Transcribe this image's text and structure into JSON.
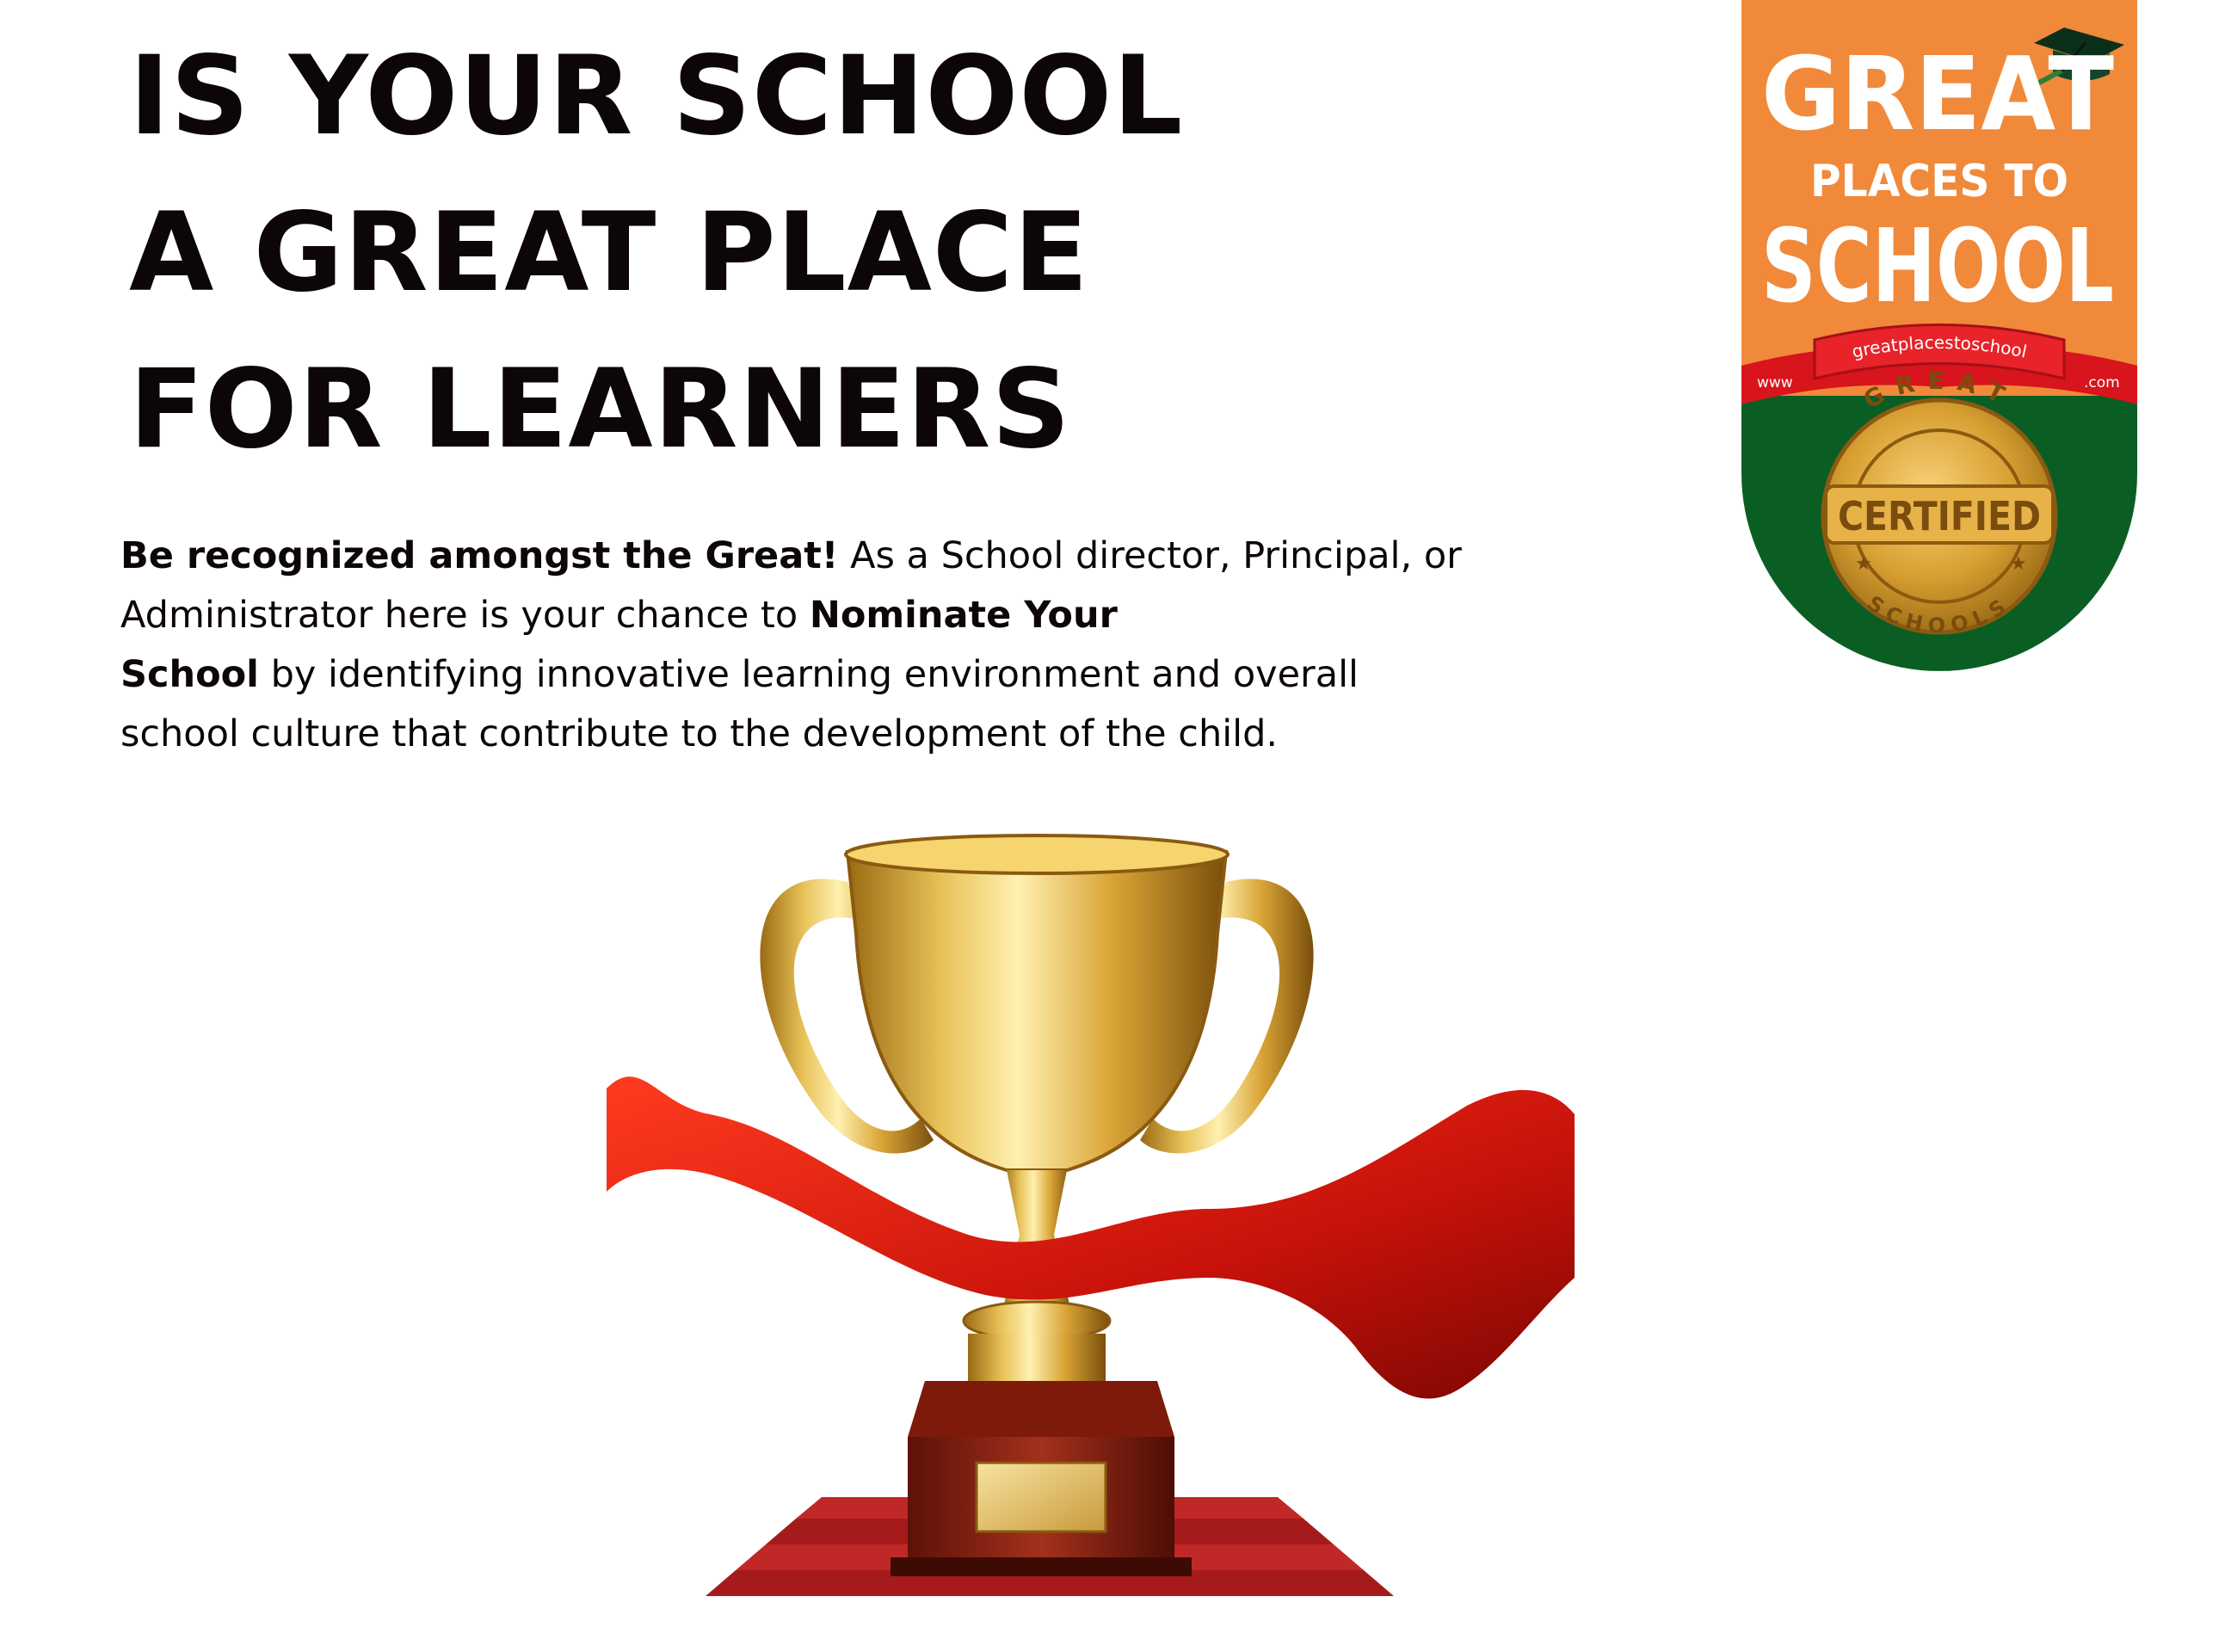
{
  "headline": {
    "lines": [
      "IS YOUR SCHOOL",
      "A GREAT PLACE",
      "FOR LEARNERS"
    ]
  },
  "intro": {
    "bold_lead": "Be recognized amongst the Great!",
    "text_1": " As a School director, Principal, or Administrator here is your chance to ",
    "bold_mid_1": "Nominate Your",
    "bold_mid_2": "School",
    "text_2": " by identifying innovative learning environment and overall school culture that contribute to the development of the child."
  },
  "badge": {
    "line_great": "GREAT",
    "line_places": "PLACES TO",
    "line_school": "SCHOOL",
    "ribbon_url": "greatplacestoschool",
    "ribbon_www": "www",
    "ribbon_com": ".com",
    "seal_top": "GREAT",
    "seal_center": "CERTIFIED",
    "seal_bottom": "SCHOOLS",
    "colors": {
      "orange": "#f0893a",
      "green": "#0b5e23",
      "red": "#d8141c",
      "gold": "#d9a032"
    }
  }
}
